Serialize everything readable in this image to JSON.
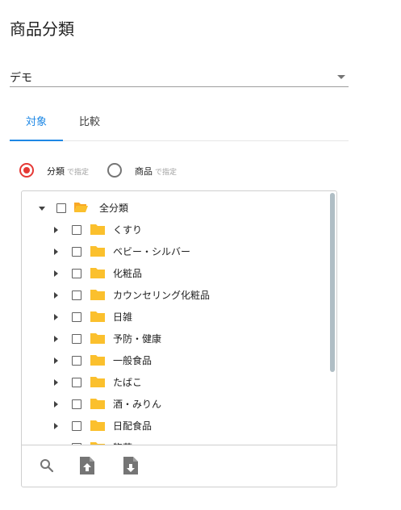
{
  "title": "商品分類",
  "select": {
    "value": "デモ"
  },
  "tabs": [
    {
      "label": "対象",
      "active": true
    },
    {
      "label": "比較",
      "active": false
    }
  ],
  "radios": [
    {
      "label": "分類",
      "suffix": "で指定",
      "selected": true
    },
    {
      "label": "商品",
      "suffix": "で指定",
      "selected": false
    }
  ],
  "tree": {
    "root": {
      "label": "全分類",
      "expanded": true,
      "icon": "folder-open-icon"
    },
    "children": [
      {
        "label": "くすり"
      },
      {
        "label": "ベビー・シルバー"
      },
      {
        "label": "化粧品"
      },
      {
        "label": "カウンセリング化粧品"
      },
      {
        "label": "日雑"
      },
      {
        "label": "予防・健康"
      },
      {
        "label": "一般食品"
      },
      {
        "label": "たばこ"
      },
      {
        "label": "酒・みりん"
      },
      {
        "label": "日配食品"
      },
      {
        "label": "惣菜"
      }
    ]
  },
  "toolbar": {
    "icons": [
      "search-icon",
      "upload-file-icon",
      "download-file-icon"
    ]
  },
  "colors": {
    "accent": "#1e88e5",
    "radio_selected": "#e53935",
    "folder": "#fbc02d",
    "scrollbar": "#b0bec5"
  }
}
